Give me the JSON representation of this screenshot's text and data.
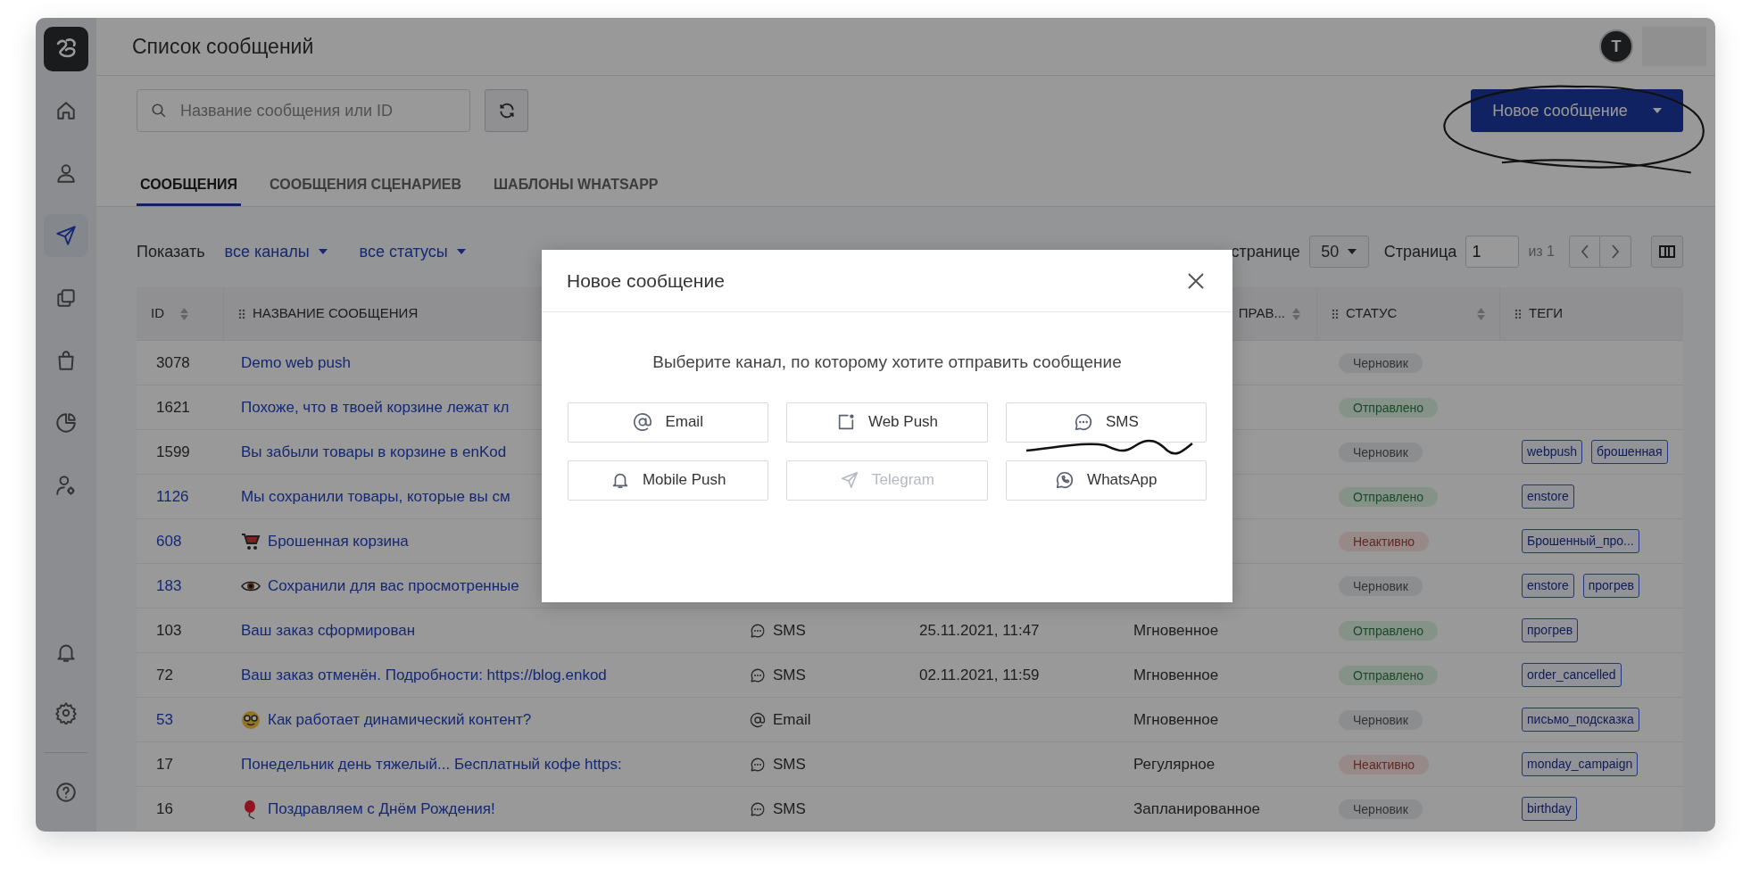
{
  "window": {
    "title": "Список сообщений"
  },
  "sidebar": {
    "items": [
      {
        "kind": "home",
        "selected": false
      },
      {
        "kind": "user",
        "selected": false
      },
      {
        "kind": "send",
        "selected": true
      },
      {
        "kind": "copy",
        "selected": false
      },
      {
        "kind": "bag",
        "selected": false
      },
      {
        "kind": "pie",
        "selected": false
      },
      {
        "kind": "user_settings",
        "selected": false
      }
    ],
    "bottom_items": [
      {
        "kind": "bell",
        "selected": false
      },
      {
        "kind": "gear",
        "selected": false
      },
      {
        "kind": "help",
        "selected": false
      }
    ]
  },
  "user": {
    "avatar_letter": "T"
  },
  "search": {
    "placeholder": "Название сообщения или ID"
  },
  "new_message_button": {
    "label": "Новое сообщение"
  },
  "tabs": [
    {
      "label": "СООБЩЕНИЯ",
      "selected": true
    },
    {
      "label": "СООБЩЕНИЯ СЦЕНАРИЕВ",
      "selected": false
    },
    {
      "label": "ШАБЛОНЫ WHATSAPP",
      "selected": false
    }
  ],
  "filters": {
    "label": "Показать",
    "dropdowns": [
      "все каналы",
      "все статусы"
    ]
  },
  "pagination": {
    "per_page_label": "странице",
    "per_page": "50",
    "page_label": "Страница",
    "page": "1",
    "total": "из 1"
  },
  "table": {
    "columns": [
      {
        "label": "ID"
      },
      {
        "label": "НАЗВАНИЕ СООБЩЕНИЯ"
      },
      {
        "label": "ПРАВ..."
      },
      {
        "label": "СТАТУС"
      },
      {
        "label": "ТЕГИ"
      }
    ],
    "rows": [
      {
        "id": "3078",
        "id_link": false,
        "name": "Demo web push",
        "status": {
          "text": "Черновик",
          "kind": "draft"
        },
        "tags": []
      },
      {
        "id": "1621",
        "id_link": false,
        "name": "Похоже, что в твоей корзине лежат кл",
        "status": {
          "text": "Отправлено",
          "kind": "sent"
        },
        "tags": []
      },
      {
        "id": "1599",
        "id_link": false,
        "name": "Вы забыли товары в корзине в enKod",
        "status": {
          "text": "Черновик",
          "kind": "draft"
        },
        "tags": [
          "webpush",
          "брошенная"
        ]
      },
      {
        "id": "1126",
        "id_link": true,
        "name": "Мы сохранили товары, которые вы см",
        "status": {
          "text": "Отправлено",
          "kind": "sent"
        },
        "tags": [
          "enstore"
        ]
      },
      {
        "id": "608",
        "id_link": true,
        "kind": "cart",
        "name": "Брошенная корзина",
        "status": {
          "text": "Неактивно",
          "kind": "inactive"
        },
        "tags": [
          "Брошенный_про..."
        ]
      },
      {
        "id": "183",
        "id_link": true,
        "kind": "eye",
        "name": "Сохранили для вас просмотренные",
        "status": {
          "text": "Черновик",
          "kind": "draft"
        },
        "tags": [
          "enstore",
          "прогрев"
        ]
      },
      {
        "id": "103",
        "id_link": false,
        "name": "Ваш заказ сформирован",
        "channel": {
          "kind": "sms",
          "label": "SMS"
        },
        "date": "25.11.2021, 11:47",
        "type": "Мгновенное",
        "status": {
          "text": "Отправлено",
          "kind": "sent"
        },
        "tags": [
          "прогрев"
        ]
      },
      {
        "id": "72",
        "id_link": false,
        "name": "Ваш заказ отменён. Подробности: https://blog.enkod",
        "channel": {
          "kind": "sms",
          "label": "SMS"
        },
        "date": "02.11.2021, 11:59",
        "type": "Мгновенное",
        "status": {
          "text": "Отправлено",
          "kind": "sent"
        },
        "tags": [
          "order_cancelled"
        ]
      },
      {
        "id": "53",
        "id_link": true,
        "kind": "smiley",
        "name": "Как работает динамический контент?",
        "channel": {
          "kind": "email",
          "label": "Email"
        },
        "type": "Мгновенное",
        "status": {
          "text": "Черновик",
          "kind": "draft"
        },
        "tags": [
          "письмо_подсказка"
        ]
      },
      {
        "id": "17",
        "id_link": false,
        "name": "Понедельник день тяжелый... Бесплатный кофе https:",
        "channel": {
          "kind": "sms",
          "label": "SMS"
        },
        "type": "Регулярное",
        "status": {
          "text": "Неактивно",
          "kind": "inactive"
        },
        "tags": [
          "monday_campaign"
        ]
      },
      {
        "id": "16",
        "id_link": false,
        "kind": "balloon",
        "name": "Поздравляем с Днём Рождения!",
        "channel": {
          "kind": "sms",
          "label": "SMS"
        },
        "type": "Запланированное",
        "status": {
          "text": "Черновик",
          "kind": "draft"
        },
        "tags": [
          "birthday"
        ]
      }
    ]
  },
  "modal": {
    "title": "Новое сообщение",
    "prompt": "Выберите канал, по которому хотите отправить сообщение",
    "channels": [
      {
        "kind": "email",
        "label": "Email",
        "disabled": false
      },
      {
        "kind": "webpush",
        "label": "Web Push",
        "disabled": false
      },
      {
        "kind": "sms",
        "label": "SMS",
        "disabled": false
      },
      {
        "kind": "mobilepush",
        "label": "Mobile Push",
        "disabled": false
      },
      {
        "kind": "telegram",
        "label": "Telegram",
        "disabled": true
      },
      {
        "kind": "whatsapp",
        "label": "WhatsApp",
        "disabled": false
      }
    ]
  }
}
